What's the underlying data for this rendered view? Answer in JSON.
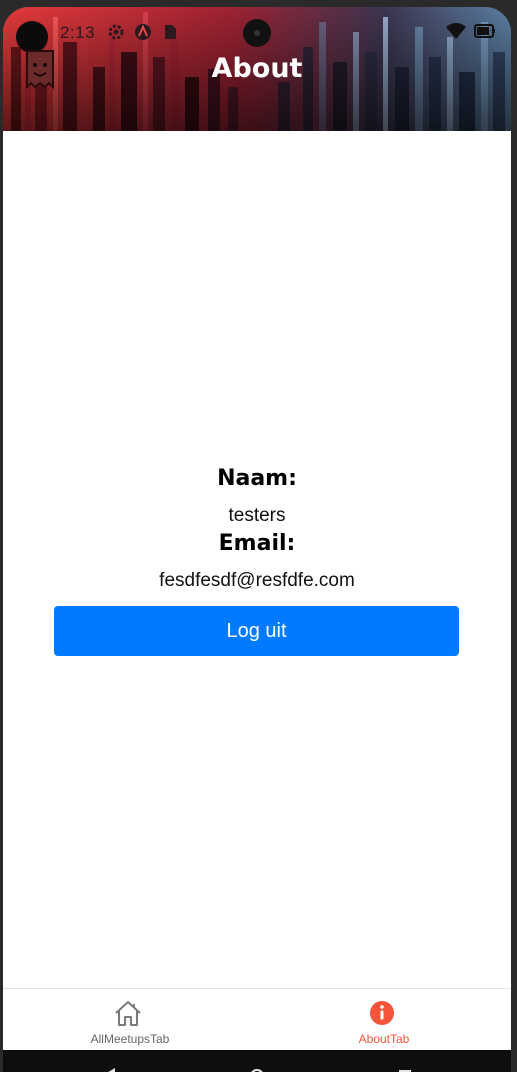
{
  "status_bar": {
    "time": "2:13",
    "icons": [
      "settings-icon",
      "app-icon",
      "sim-icon",
      "wifi-icon",
      "battery-icon"
    ]
  },
  "header": {
    "title": "About",
    "logo_icon": "ghost-bag-logo-icon"
  },
  "profile": {
    "name_label": "Naam:",
    "name_value": "testers",
    "email_label": "Email:",
    "email_value": "fesdfesdf@resfdfe.com",
    "logout_label": "Log uit"
  },
  "tabs": [
    {
      "label": "AllMeetupsTab",
      "icon": "home-icon",
      "active": false,
      "color": "#7a7a7a"
    },
    {
      "label": "AboutTab",
      "icon": "info-icon",
      "active": true,
      "color": "#f4553a"
    }
  ],
  "colors": {
    "button": "#007bff",
    "active_tab": "#f4553a",
    "inactive_tab": "#7a7a7a"
  },
  "system_nav": [
    "back-icon",
    "home-circle-icon",
    "recents-icon"
  ]
}
